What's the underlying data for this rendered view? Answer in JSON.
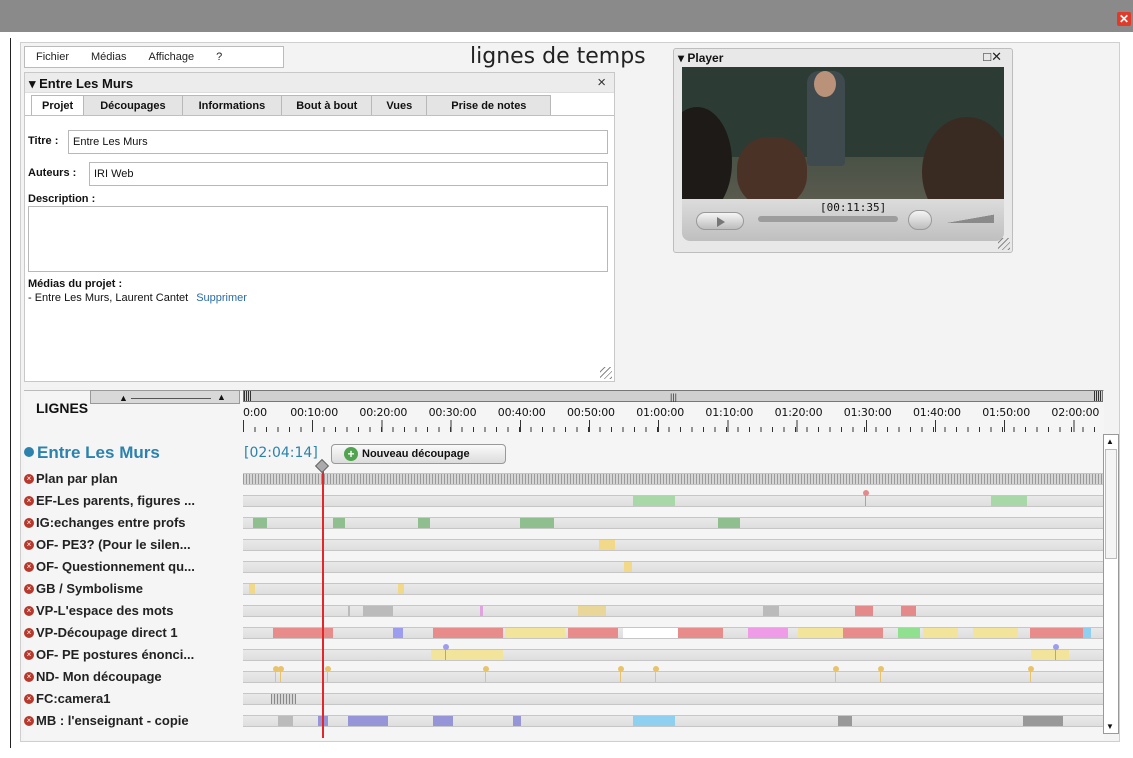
{
  "window": {
    "close_label": "✕"
  },
  "menu": {
    "items": [
      "Fichier",
      "Médias",
      "Affichage",
      "?"
    ]
  },
  "app_title": "lignes de temps",
  "project": {
    "panel_title": "▾ Entre Les Murs",
    "close": "×",
    "tabs": [
      "Projet",
      "Découpages",
      "Informations",
      "Bout à bout",
      "Vues",
      "Prise de notes"
    ],
    "titre_label": "Titre :",
    "titre_value": "Entre Les Murs",
    "auteurs_label": "Auteurs :",
    "auteurs_value": "IRI Web",
    "description_label": "Description :",
    "description_value": "",
    "medias_label": "Médias du projet :",
    "media_item": "- Entre Les Murs, Laurent Cantet",
    "supprimer": "Supprimer"
  },
  "player": {
    "title": "▾ Player",
    "controls": "□✕",
    "time": "[00:11:35]"
  },
  "timeline": {
    "title": "LIGNES",
    "ticks": [
      "0:00",
      "00:10:00",
      "00:20:00",
      "00:30:00",
      "00:40:00",
      "00:50:00",
      "01:00:00",
      "01:10:00",
      "01:20:00",
      "01:30:00",
      "01:40:00",
      "01:50:00",
      "02:00:00"
    ],
    "project_name": "Entre Les Murs",
    "current_time": "[02:04:14]",
    "new_button": "Nouveau découpage",
    "rows": [
      "Plan par plan",
      "EF-Les parents, figures ...",
      "IG:echanges entre profs",
      "OF- PE3? (Pour le silen...",
      "OF- Questionnement qu...",
      "GB / Symbolisme",
      "VP-L'espace des mots",
      "VP-Découpage direct 1",
      "OF- PE postures énonci...",
      "ND- Mon découpage",
      "FC:camera1",
      "MB : l'enseignant - copie"
    ]
  }
}
